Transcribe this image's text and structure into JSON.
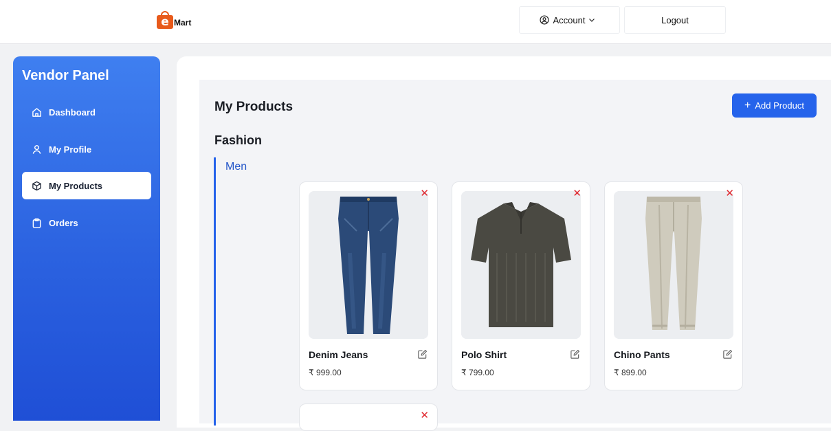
{
  "brand": {
    "logo_letter": "e",
    "logo_text": "Mart",
    "accent": "#e85a1b"
  },
  "topbar": {
    "account_label": "Account",
    "logout_label": "Logout"
  },
  "sidebar": {
    "title": "Vendor Panel",
    "items": [
      {
        "label": "Dashboard",
        "icon": "home-icon"
      },
      {
        "label": "My Profile",
        "icon": "user-icon"
      },
      {
        "label": "My Products",
        "icon": "box-icon",
        "active": true
      },
      {
        "label": "Orders",
        "icon": "clipboard-icon"
      }
    ]
  },
  "main": {
    "title": "My Products",
    "add_button_label": "Add Product",
    "category": "Fashion",
    "subcategory": "Men",
    "products": [
      {
        "name": "Denim Jeans",
        "price": "₹ 999.00",
        "image": "jeans"
      },
      {
        "name": "Polo Shirt",
        "price": "₹ 799.00",
        "image": "polo-shirt"
      },
      {
        "name": "Chino Pants",
        "price": "₹ 899.00",
        "image": "chino-pants"
      }
    ]
  },
  "colors": {
    "primary": "#2563eb",
    "delete": "#e0282f",
    "sidebar_top": "#3f7ff0",
    "sidebar_bottom": "#1f4fd6"
  }
}
